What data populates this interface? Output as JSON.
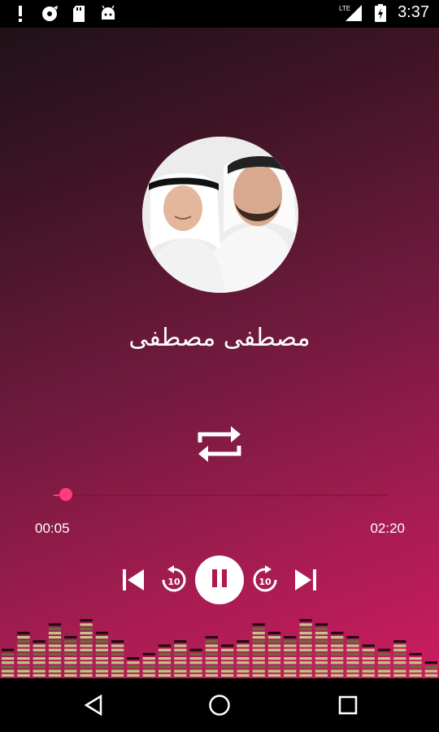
{
  "status_bar": {
    "left_icons": [
      "alert-icon",
      "cd-icon",
      "sd-card-icon",
      "android-icon"
    ],
    "network": "LTE",
    "time": "3:37"
  },
  "player": {
    "track_title": "مصطفى مصطفى",
    "current_time": "00:05",
    "total_time": "02:20",
    "progress_fraction": 0.036,
    "controls": {
      "previous": "skip-previous-icon",
      "rewind": "replay-10-icon",
      "rewind_label": "10",
      "play_pause": "pause-icon",
      "forward": "forward-10-icon",
      "forward_label": "10",
      "next": "skip-next-icon",
      "repeat": "repeat-icon"
    }
  },
  "colors": {
    "accent": "#ff3b7a",
    "gradient_start": "#1b1116",
    "gradient_end": "#d81d63"
  },
  "nav_bar": [
    "back-icon",
    "home-icon",
    "recents-icon"
  ]
}
